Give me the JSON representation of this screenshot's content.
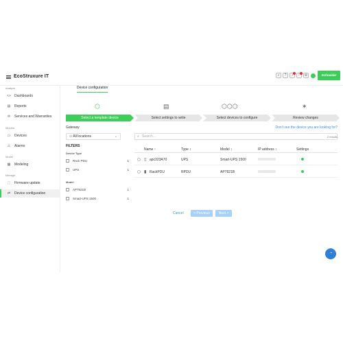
{
  "app": {
    "logo": "EcoStruxure IT",
    "brand": "Schneider"
  },
  "sidebar": {
    "sections": [
      "Analyze",
      "Monitor",
      "Model",
      "Manage"
    ],
    "items": [
      {
        "label": "Dashboards",
        "icon": "<>"
      },
      {
        "label": "Reports",
        "icon": "▤"
      },
      {
        "label": "Services and Warranties",
        "icon": "✉"
      },
      {
        "label": "Devices",
        "icon": "▭"
      },
      {
        "label": "Alarms",
        "icon": "⚠"
      },
      {
        "label": "Modeling",
        "icon": "▦"
      },
      {
        "label": "Firmware update",
        "icon": "⬚"
      },
      {
        "label": "Device configuration",
        "icon": "⇄"
      }
    ]
  },
  "main": {
    "page_tab": "Device configuration",
    "steps": [
      "Select a template device",
      "Select settings to write",
      "Select devices to configure",
      "Review changes"
    ],
    "gateway_label": "Gateway",
    "not_see_link": "Don't see the device you are looking for?",
    "location_select": "All locations",
    "filters_title": "FILTERS",
    "filter_groups": [
      {
        "title": "Device Type",
        "options": [
          {
            "label": "Rack PDU",
            "count": "1"
          },
          {
            "label": "UPS",
            "count": "1"
          }
        ]
      },
      {
        "title": "Model",
        "options": [
          {
            "label": "AP7821B",
            "count": "1"
          },
          {
            "label": "Smart-UPS 1500",
            "count": "1"
          }
        ]
      }
    ],
    "search_placeholder": "Search...",
    "results_count": "2 results",
    "columns": [
      "Name ↑",
      "Type ↕",
      "Model ↕",
      "IP address ↕",
      "Settings"
    ],
    "rows": [
      {
        "name": "apc323A70",
        "type": "UPS",
        "model": "Smart-UPS 1500"
      },
      {
        "name": "RackPDU",
        "type": "RPDU",
        "model": "AP7821B"
      }
    ],
    "cancel": "Cancel",
    "previous": "< Previous",
    "next": "Next >"
  },
  "colors": {
    "accent": "#3dcd58",
    "link": "#3d8fd6",
    "fab": "#2f7fd6"
  }
}
